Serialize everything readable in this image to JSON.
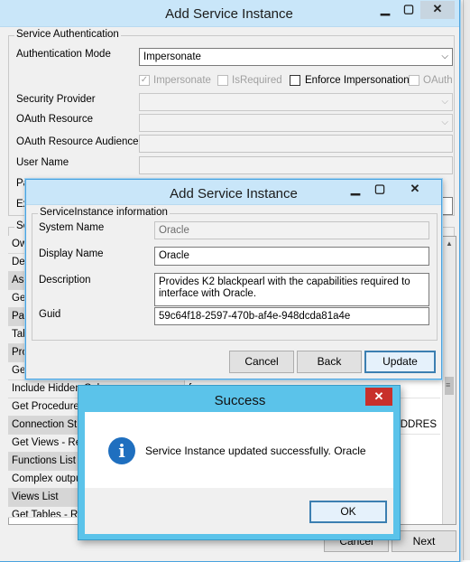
{
  "main_dialog": {
    "title": "Add Service Instance",
    "title_buttons": [
      "▁",
      "▢",
      "✕"
    ],
    "auth_group_label": "Service Authentication",
    "auth_mode_label": "Authentication Mode",
    "auth_mode_value": "Impersonate",
    "checkboxes": [
      {
        "label": "Impersonate",
        "checked": true,
        "enabled": false
      },
      {
        "label": "IsRequired",
        "checked": false,
        "enabled": false
      },
      {
        "label": "Enforce Impersonation",
        "checked": false,
        "enabled": true
      },
      {
        "label": "OAuth",
        "checked": false,
        "enabled": false
      }
    ],
    "security_provider_label": "Security Provider",
    "oauth_resource_label": "OAuth Resource",
    "oauth_audience_label": "OAuth Resource Audience",
    "user_name_label": "User Name",
    "password_label_partial": "Pa",
    "extra_label_partial": "Ex",
    "settings_label_partial": "Ser",
    "property_rows": [
      {
        "name": "Ow",
        "value": "",
        "category": false
      },
      {
        "name": "Dec",
        "value": "",
        "category": false
      },
      {
        "name": "Asc",
        "value": "",
        "category": true
      },
      {
        "name": "Get",
        "value": "",
        "category": false
      },
      {
        "name": "Pac",
        "value": "",
        "category": true
      },
      {
        "name": "Tab",
        "value": "",
        "category": false
      },
      {
        "name": "Proc",
        "value": "",
        "category": true
      },
      {
        "name": "Get",
        "value": "",
        "category": false
      },
      {
        "name": "Include Hidden Columns",
        "value": "f",
        "category": false
      },
      {
        "name": "Get Procedures",
        "value": "",
        "category": false
      },
      {
        "name": "Connection String",
        "value": "ADDRES",
        "category": true
      },
      {
        "name": "Get Views - Rec",
        "value": "",
        "category": false
      },
      {
        "name": "Functions List",
        "value": "",
        "category": true
      },
      {
        "name": "Complex output",
        "value": "",
        "category": false
      },
      {
        "name": "Views List",
        "value": "",
        "category": true
      },
      {
        "name": "Get Tables - Re",
        "value": "",
        "category": false
      }
    ],
    "cancel_label": "Cancel",
    "next_label": "Next"
  },
  "sub_dialog": {
    "title": "Add Service Instance",
    "title_buttons": [
      "▁",
      "▢",
      "✕"
    ],
    "group_label": "ServiceInstance information",
    "system_name_label": "System Name",
    "system_name_value": "Oracle",
    "display_name_label": "Display Name",
    "display_name_value": "Oracle",
    "description_label": "Description",
    "description_value": "Provides K2 blackpearl with the capabilities required to interface with Oracle.",
    "guid_label": "Guid",
    "guid_value": "59c64f18-2597-470b-af4e-948dcda81a4e",
    "cancel_label": "Cancel",
    "back_label": "Back",
    "update_label": "Update"
  },
  "success_dialog": {
    "title": "Success",
    "close_glyph": "✕",
    "info_glyph": "i",
    "message": "Service Instance updated successfully.  Oracle",
    "ok_label": "OK"
  },
  "colors": {
    "titlebar": "#c9e6f9",
    "success_titlebar": "#5bc3ea",
    "close_red": "#c8302b",
    "info_blue": "#1f6fbf"
  }
}
